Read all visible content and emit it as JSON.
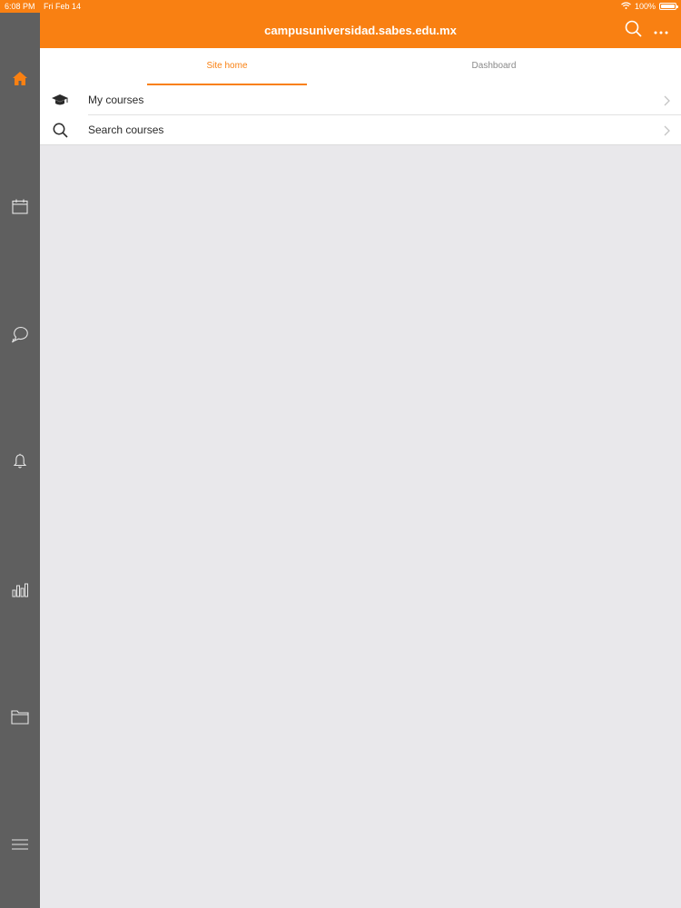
{
  "status_bar": {
    "time": "6:08 PM",
    "date": "Fri Feb 14",
    "battery": "100%",
    "battery_level": 1.0,
    "icons": [
      "wifi-icon",
      "battery-icon"
    ]
  },
  "header": {
    "title": "campusuniversidad.sabes.edu.mx",
    "icons": [
      "search-icon",
      "more-icon"
    ]
  },
  "sidebar": {
    "items": [
      {
        "name": "home",
        "icon": "home-icon",
        "active": true
      },
      {
        "name": "calendar",
        "icon": "calendar-icon",
        "active": false
      },
      {
        "name": "messages",
        "icon": "chat-icon",
        "active": false
      },
      {
        "name": "notifications",
        "icon": "bell-icon",
        "active": false
      },
      {
        "name": "grades",
        "icon": "bar-chart-icon",
        "active": false
      },
      {
        "name": "files",
        "icon": "folder-icon",
        "active": false
      },
      {
        "name": "menu",
        "icon": "menu-icon",
        "active": false
      }
    ]
  },
  "tabs": [
    {
      "label": "Site home",
      "active": true
    },
    {
      "label": "Dashboard",
      "active": false
    }
  ],
  "list": [
    {
      "label": "My courses",
      "icon": "graduation-cap-icon"
    },
    {
      "label": "Search courses",
      "icon": "search-icon"
    }
  ],
  "colors": {
    "accent": "#f98012",
    "sidebar": "#5f5f5f",
    "background": "#e9e8eb",
    "inactive_tab": "#8a8a8a"
  }
}
